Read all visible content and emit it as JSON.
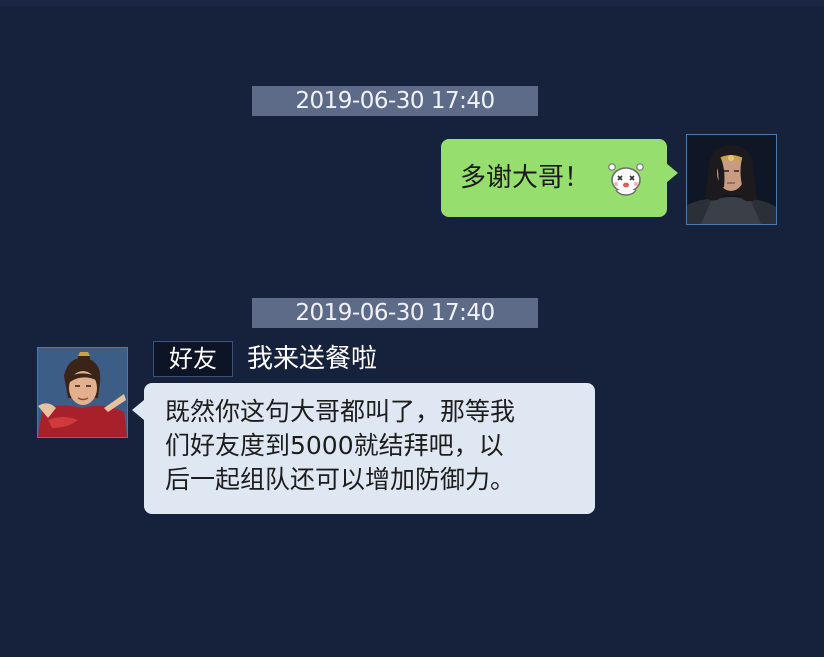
{
  "conversation": {
    "messages": [
      {
        "timestamp": "2019-06-30 17:40",
        "direction": "outgoing",
        "text": "多谢大哥！",
        "emoji_icon": "happy-face-emoji-icon",
        "avatar_icon": "warrior-avatar-icon"
      },
      {
        "timestamp": "2019-06-30 17:40",
        "direction": "incoming",
        "sender_tag": "好友",
        "sender_name": "我来送餐啦",
        "avatar_icon": "young-hero-avatar-icon",
        "text_lines": [
          "既然你这句大哥都叫了，那等我",
          "们好友度到5000就结拜吧，以",
          "后一起组队还可以增加防御力。"
        ]
      }
    ]
  },
  "colors": {
    "background": "#16213b",
    "timestamp_bg": "#5d6a88",
    "sent_bubble": "#96de6d",
    "received_bubble": "#dfe8f2",
    "avatar_border": "#4a7bb0"
  }
}
